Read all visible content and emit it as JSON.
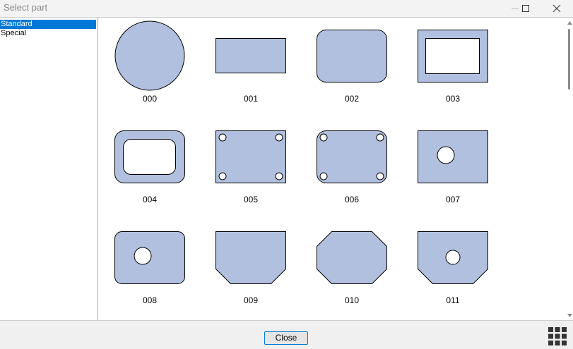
{
  "window": {
    "title": "Select part",
    "buttons": [
      "minimize-icon",
      "maximize-icon",
      "close-icon"
    ]
  },
  "tree": {
    "items": [
      {
        "label": "Standard",
        "selected": true
      },
      {
        "label": "Special",
        "selected": false
      }
    ]
  },
  "parts": [
    {
      "id": "000",
      "shape": "circle"
    },
    {
      "id": "001",
      "shape": "rectangle"
    },
    {
      "id": "002",
      "shape": "rounded-rectangle"
    },
    {
      "id": "003",
      "shape": "rectangle-rectangular-cutout"
    },
    {
      "id": "004",
      "shape": "rounded-rectangle-rounded-cutout"
    },
    {
      "id": "005",
      "shape": "rectangle-four-corner-holes"
    },
    {
      "id": "006",
      "shape": "rounded-rectangle-four-corner-holes"
    },
    {
      "id": "007",
      "shape": "rectangle-center-hole"
    },
    {
      "id": "008",
      "shape": "rounded-rectangle-offset-hole"
    },
    {
      "id": "009",
      "shape": "rectangle-chamfered-bottom"
    },
    {
      "id": "010",
      "shape": "octagon"
    },
    {
      "id": "011",
      "shape": "rectangle-chamfered-bottom-center-hole"
    }
  ],
  "footer": {
    "close_label": "Close",
    "view_icon": "grid-view-icon"
  },
  "colors": {
    "shape_fill": "#b0c0de",
    "shape_stroke": "#000000",
    "selection": "#0078d7"
  }
}
